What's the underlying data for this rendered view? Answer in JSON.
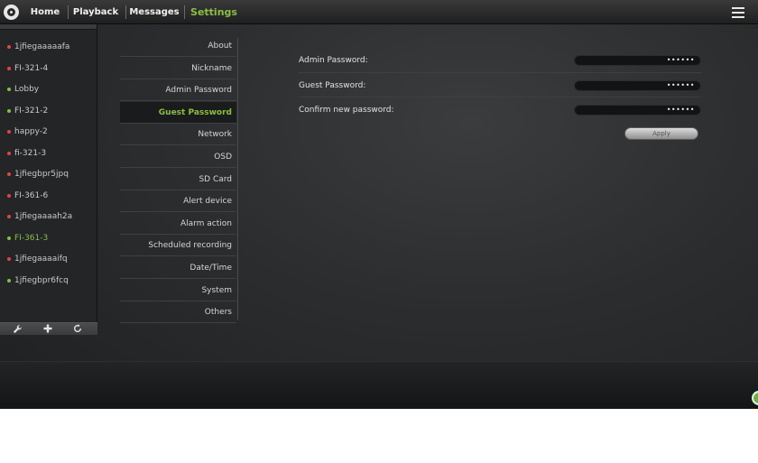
{
  "nav": {
    "tabs": [
      {
        "label": "Home"
      },
      {
        "label": "Playback"
      },
      {
        "label": "Messages"
      },
      {
        "label": "Settings",
        "active": true
      }
    ]
  },
  "devices": [
    {
      "label": "1jfiegaaaaafa",
      "status": "offline"
    },
    {
      "label": "FI-321-4",
      "status": "offline"
    },
    {
      "label": "Lobby",
      "status": "online"
    },
    {
      "label": "FI-321-2",
      "status": "online"
    },
    {
      "label": "happy-2",
      "status": "offline"
    },
    {
      "label": "fi-321-3",
      "status": "offline"
    },
    {
      "label": "1jfiegbpr5jpq",
      "status": "offline"
    },
    {
      "label": "FI-361-6",
      "status": "offline"
    },
    {
      "label": "1jfiegaaaah2a",
      "status": "offline"
    },
    {
      "label": "FI-361-3",
      "status": "online",
      "selected": true
    },
    {
      "label": "1jfiegaaaaifq",
      "status": "offline"
    },
    {
      "label": "1jfiegbpr6fcq",
      "status": "online"
    }
  ],
  "settings_menu": [
    {
      "label": "About"
    },
    {
      "label": "Nickname"
    },
    {
      "label": "Admin Password"
    },
    {
      "label": "Guest Password",
      "active": true
    },
    {
      "label": "Network"
    },
    {
      "label": "OSD"
    },
    {
      "label": "SD Card"
    },
    {
      "label": "Alert device"
    },
    {
      "label": "Alarm action"
    },
    {
      "label": "Scheduled recording"
    },
    {
      "label": "Date/Time"
    },
    {
      "label": "System"
    },
    {
      "label": "Others"
    }
  ],
  "form": {
    "admin_password_label": "Admin Password:",
    "admin_password_value": "••••••",
    "guest_password_label": "Guest Password:",
    "guest_password_value": "••••••",
    "confirm_password_label": "Confirm new password:",
    "confirm_password_value": "••••••",
    "apply_label": "Apply"
  },
  "icons": {
    "toolbar": [
      "wrench-icon",
      "plus-icon",
      "refresh-icon"
    ]
  },
  "colors": {
    "accent": "#8cbf3e",
    "online": "#7fc241",
    "offline": "#e0483a"
  }
}
